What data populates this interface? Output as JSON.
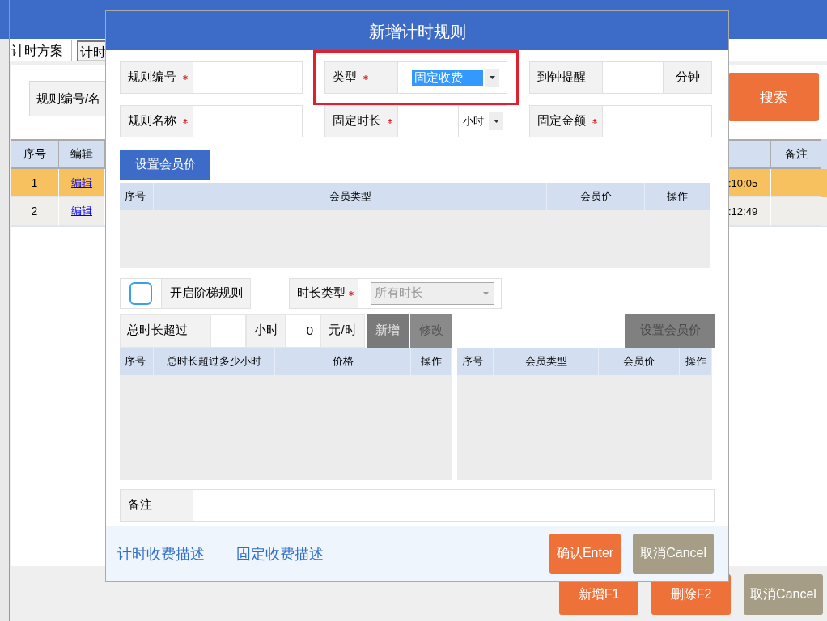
{
  "background": {
    "tabs": [
      {
        "label": "计时方案",
        "selected": true
      },
      {
        "label": "计时",
        "selected": false
      }
    ],
    "search": {
      "label": "规则编号/名",
      "button": "搜索"
    },
    "table": {
      "columns": [
        "序号",
        "编辑",
        "备注"
      ],
      "rows": [
        {
          "number": "1",
          "edit": "编辑",
          "time": ":10:05",
          "selected": true
        },
        {
          "number": "2",
          "edit": "编辑",
          "time": ":12:49",
          "selected": false
        }
      ]
    },
    "buttons": [
      {
        "label": "新增F1",
        "kind": "primary"
      },
      {
        "label": "删除F2",
        "kind": "primary"
      },
      {
        "label": "取消Cancel",
        "kind": "secondary"
      }
    ]
  },
  "dialog": {
    "title": "新增计时规则",
    "fields": [
      {
        "label": "规则编号",
        "required": true,
        "kind": "text"
      },
      {
        "label": "类型",
        "required": true,
        "kind": "select",
        "value": "固定收费",
        "highlighted": true
      },
      {
        "label": "到钟提醒",
        "required": false,
        "kind": "suffix",
        "suffix": "分钟"
      },
      {
        "label": "规则名称",
        "required": true,
        "kind": "text"
      },
      {
        "label": "固定时长",
        "required": true,
        "kind": "unit-select",
        "unit": "小时"
      },
      {
        "label": "固定金额",
        "required": true,
        "kind": "text"
      }
    ],
    "member_price_button": "设置会员价",
    "member_table": {
      "columns": [
        "序号",
        "会员类型",
        "会员价",
        "操作"
      ]
    },
    "ladder": {
      "checkbox": {
        "label": "开启阶梯规则",
        "checked": false
      },
      "duration_type": {
        "label": "时长类型",
        "required": true,
        "value": "所有时长",
        "disabled": true
      },
      "over_label": "总时长超过",
      "hour_unit": "小时",
      "price_value": "0",
      "price_unit": "元/时",
      "buttons": [
        {
          "label": "新增"
        },
        {
          "label": "修改"
        }
      ],
      "member_price_button": {
        "label": "设置会员价",
        "disabled": true
      },
      "tier_table": {
        "columns": [
          "序号",
          "总时长超过多少小时",
          "价格",
          "操作"
        ]
      },
      "member_table": {
        "columns": [
          "序号",
          "会员类型",
          "会员价",
          "操作"
        ]
      }
    },
    "remark": {
      "label": "备注"
    },
    "links": [
      "计时收费描述",
      "固定收费描述"
    ],
    "buttons": [
      {
        "label": "确认Enter",
        "kind": "primary"
      },
      {
        "label": "取消Cancel",
        "kind": "secondary"
      }
    ]
  }
}
